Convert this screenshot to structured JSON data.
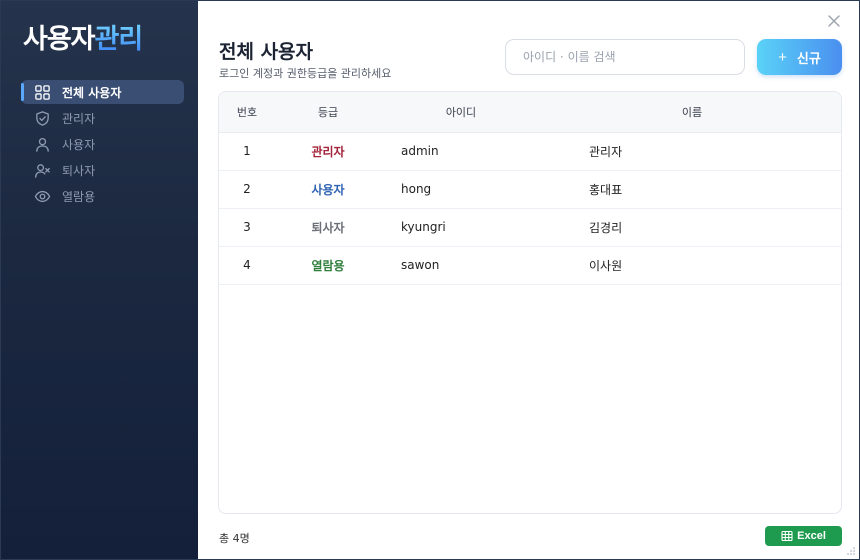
{
  "app": {
    "logo_white": "사용자",
    "logo_blue": "관리"
  },
  "sidebar": {
    "items": [
      {
        "label": "전체 사용자",
        "icon": "grid-icon",
        "active": true
      },
      {
        "label": "관리자",
        "icon": "shield-check-icon",
        "active": false
      },
      {
        "label": "사용자",
        "icon": "user-icon",
        "active": false
      },
      {
        "label": "퇴사자",
        "icon": "user-x-icon",
        "active": false
      },
      {
        "label": "열람용",
        "icon": "eye-icon",
        "active": false
      }
    ]
  },
  "header": {
    "title": "전체 사용자",
    "subtitle": "로그인 계정과 권한등급을 관리하세요",
    "search_placeholder": "아이디 · 이름 검색",
    "new_plus": "+",
    "new_label": "신규"
  },
  "table": {
    "columns": [
      "번호",
      "등급",
      "아이디",
      "이름"
    ],
    "rows": [
      {
        "num": "1",
        "grade": "관리자",
        "grade_color": "#a3233a",
        "id": "admin",
        "name": "관리자"
      },
      {
        "num": "2",
        "grade": "사용자",
        "grade_color": "#2f63b3",
        "id": "hong",
        "name": "홍대표"
      },
      {
        "num": "3",
        "grade": "퇴사자",
        "grade_color": "#6a6f78",
        "id": "kyungri",
        "name": "김경리"
      },
      {
        "num": "4",
        "grade": "열람용",
        "grade_color": "#2e7d3a",
        "id": "sawon",
        "name": "이사원"
      }
    ]
  },
  "footer": {
    "count": "총 4명",
    "excel_label": "Excel",
    "excel_color": "#1f9b4f"
  },
  "colors": {
    "sidebar_bg": "#1b2840",
    "accent": "#4a8ff0"
  }
}
